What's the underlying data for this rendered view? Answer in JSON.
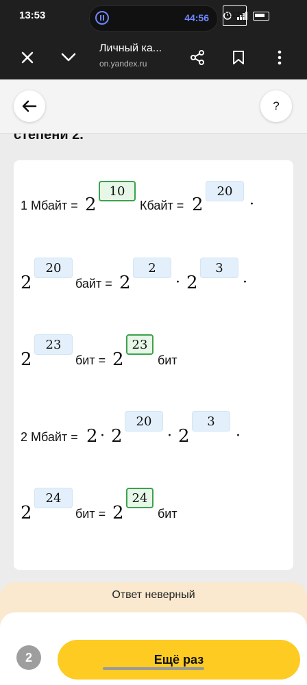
{
  "status_bar": {
    "time": "13:53",
    "timer": "44:56",
    "battery_label": "",
    "net_label": "VoLTE"
  },
  "browser": {
    "title": "Личный ка...",
    "url": "on.yandex.ru"
  },
  "page": {
    "heading_fragment": "степени 2.",
    "help_label": "?"
  },
  "rows": {
    "r1": {
      "label": "1 Мбайт =",
      "base1": "2",
      "exp1": "10",
      "unit1": "Кбайт =",
      "base2": "2",
      "exp2": "20",
      "dot": "·"
    },
    "r2": {
      "base1": "2",
      "exp1": "20",
      "unit1": "байт =",
      "base2": "2",
      "exp2": "2",
      "mul": "·",
      "base3": "2",
      "exp3": "3",
      "dot": "·"
    },
    "r3": {
      "base1": "2",
      "exp1": "23",
      "unit1": "бит =",
      "base2": "2",
      "exp2": "23",
      "unit2": "бит"
    },
    "r4": {
      "label": "2 Мбайт =",
      "base1": "2",
      "mul1": "·",
      "base2": "2",
      "exp2": "20",
      "mul2": "·",
      "base3": "2",
      "exp3": "3",
      "dot": "·"
    },
    "r5": {
      "base1": "2",
      "exp1": "24",
      "unit1": "бит =",
      "base2": "2",
      "exp2": "24",
      "unit2": "бит"
    }
  },
  "feedback": {
    "text": "Ответ неверный",
    "attempt": "2",
    "retry_label": "Ещё раз"
  },
  "colors": {
    "accent_yellow": "#fdcb21",
    "correct_green": "#3ca24b",
    "input_blue": "#e3f0fb",
    "feedback_bg": "#fae8cf"
  }
}
